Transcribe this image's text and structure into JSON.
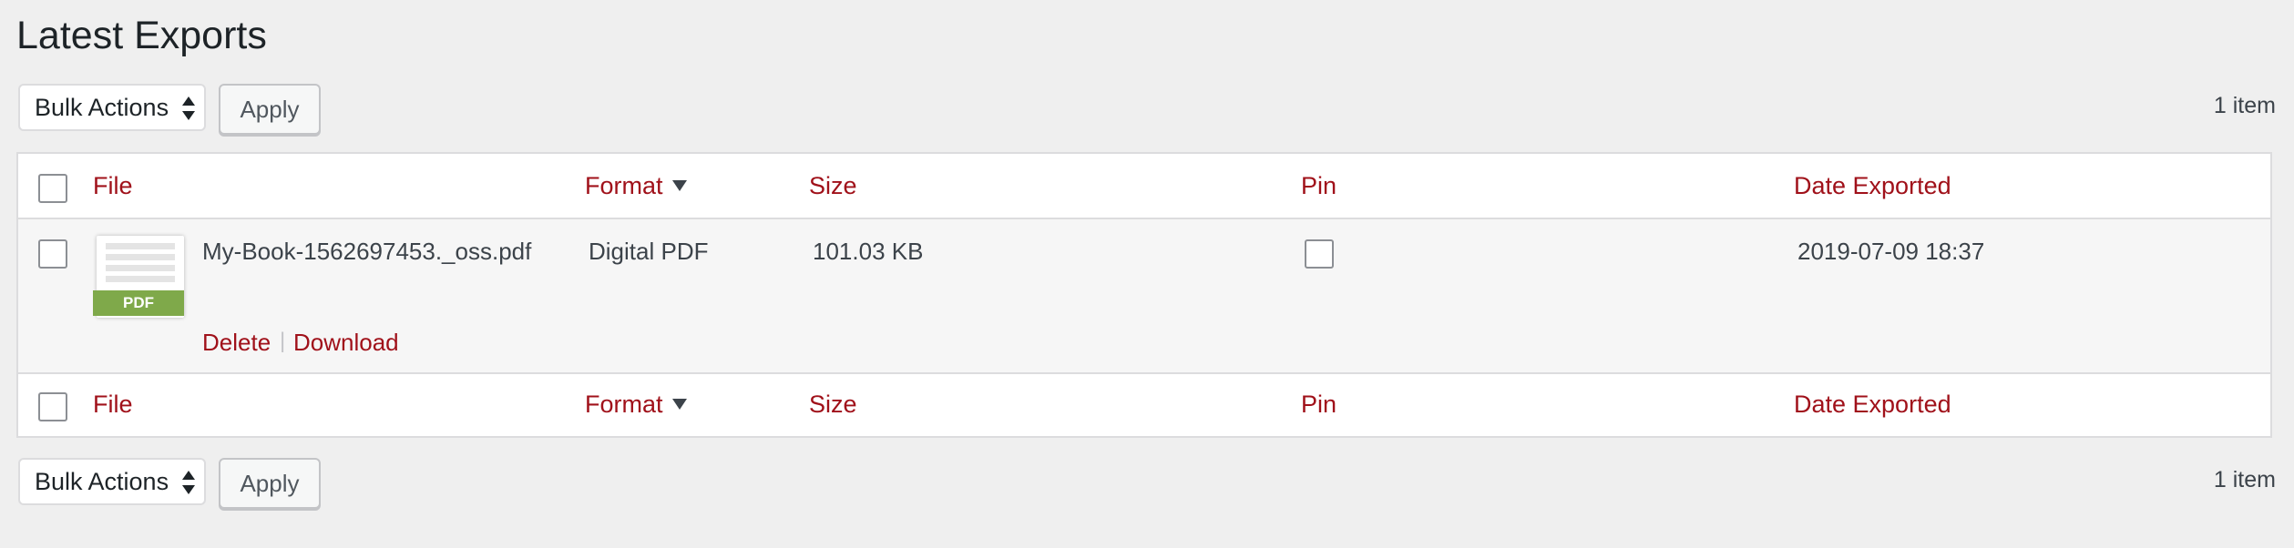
{
  "page": {
    "title": "Latest Exports"
  },
  "toolbar_top": {
    "bulk_actions": "Bulk Actions",
    "apply": "Apply",
    "count": "1 item"
  },
  "toolbar_bottom": {
    "bulk_actions": "Bulk Actions",
    "apply": "Apply",
    "count": "1 item"
  },
  "columns": {
    "file": "File",
    "format": "Format",
    "size": "Size",
    "pin": "Pin",
    "date": "Date Exported"
  },
  "rows": [
    {
      "file_name": "My-Book-1562697453._oss.pdf",
      "thumb_badge": "PDF",
      "format": "Digital PDF",
      "size": "101.03 KB",
      "pinned": false,
      "date": "2019-07-09 18:37",
      "actions": {
        "delete": "Delete",
        "separator": "|",
        "download": "Download"
      }
    }
  ],
  "colors": {
    "link": "#a0111a",
    "badge": "#7fa94a",
    "background": "#efefef"
  }
}
